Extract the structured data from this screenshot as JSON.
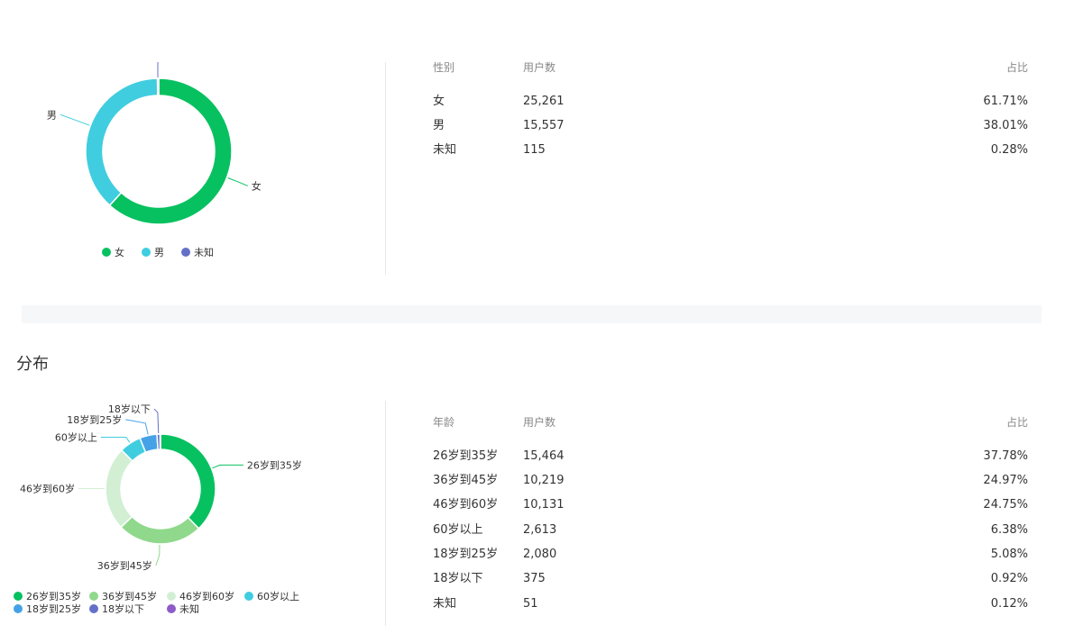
{
  "gender": {
    "table": {
      "headers": [
        "性别",
        "用户数",
        "占比"
      ],
      "rows": [
        {
          "label": "女",
          "count": "25,261",
          "share": "61.71%"
        },
        {
          "label": "男",
          "count": "15,557",
          "share": "38.01%"
        },
        {
          "label": "未知",
          "count": "115",
          "share": "0.28%"
        }
      ]
    }
  },
  "age": {
    "title": "分布",
    "table": {
      "headers": [
        "年龄",
        "用户数",
        "占比"
      ],
      "rows": [
        {
          "label": "26岁到35岁",
          "count": "15,464",
          "share": "37.78%"
        },
        {
          "label": "36岁到45岁",
          "count": "10,219",
          "share": "24.97%"
        },
        {
          "label": "46岁到60岁",
          "count": "10,131",
          "share": "24.75%"
        },
        {
          "label": "60岁以上",
          "count": "2,613",
          "share": "6.38%"
        },
        {
          "label": "18岁到25岁",
          "count": "2,080",
          "share": "5.08%"
        },
        {
          "label": "18岁以下",
          "count": "375",
          "share": "0.92%"
        },
        {
          "label": "未知",
          "count": "51",
          "share": "0.12%"
        }
      ]
    }
  },
  "chart_data": [
    {
      "type": "pie",
      "variant": "donut",
      "categories": [
        "女",
        "男",
        "未知"
      ],
      "values": [
        25261,
        15557,
        115
      ],
      "colors": [
        "#07c160",
        "#40cde0",
        "#6470c8"
      ],
      "legend": [
        "女",
        "男",
        "未知"
      ],
      "legend_position": "bottom"
    },
    {
      "type": "pie",
      "variant": "donut",
      "categories": [
        "26岁到35岁",
        "36岁到45岁",
        "46岁到60岁",
        "60岁以上",
        "18岁到25岁",
        "18岁以下",
        "未知"
      ],
      "values": [
        15464,
        10219,
        10131,
        2613,
        2080,
        375,
        51
      ],
      "colors": [
        "#07c160",
        "#8fd88c",
        "#d2efd4",
        "#40cde0",
        "#46a2e6",
        "#6470c8",
        "#8c5cc8"
      ],
      "legend": [
        "26岁到35岁",
        "36岁到45岁",
        "46岁到60岁",
        "60岁以上",
        "18岁到25岁",
        "18岁以下",
        "未知"
      ],
      "legend_position": "bottom"
    }
  ]
}
